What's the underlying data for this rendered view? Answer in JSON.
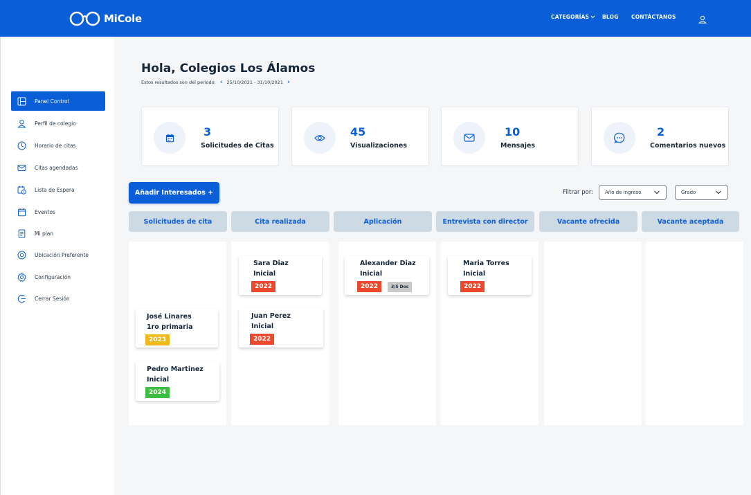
{
  "header": {
    "logo_text": "MiCole",
    "nav": {
      "categories": "CATEGORÍAS",
      "blog": "BLOG",
      "contact": "CONTÁCTANOS"
    }
  },
  "sidebar": {
    "items": [
      {
        "label": "Panel Control",
        "icon": "layout-icon",
        "active": true
      },
      {
        "label": "Perfil de colegio",
        "icon": "user-icon"
      },
      {
        "label": "Horario de citas",
        "icon": "clock-icon"
      },
      {
        "label": "Citas agendadas",
        "icon": "mail-icon"
      },
      {
        "label": "Lista de Espera",
        "icon": "calendar-clock-icon"
      },
      {
        "label": "Eventos",
        "icon": "calendar-icon"
      },
      {
        "label": "Mi plan",
        "icon": "document-icon"
      },
      {
        "label": "Ubicación Preferente",
        "icon": "location-icon"
      },
      {
        "label": "Configuración",
        "icon": "gear-icon"
      },
      {
        "label": "Cerrar Sesión",
        "icon": "logout-icon"
      }
    ]
  },
  "main": {
    "greeting": "Hola, Colegios Los Álamos",
    "period_label": "Estos resultados son del periodo:",
    "period_range": "25/10/2021 - 31/10/2021",
    "stats": [
      {
        "value": "3",
        "caption": "Solicitudes de Citas",
        "icon": "calendar-icon"
      },
      {
        "value": "45",
        "caption": "Visualizaciones",
        "icon": "eye-icon"
      },
      {
        "value": "10",
        "caption": "Mensajes",
        "icon": "envelope-icon"
      },
      {
        "value": "2",
        "caption": "Comentarios nuevos",
        "icon": "chat-bubble-icon"
      }
    ],
    "add_button": "Añadir Interesados +",
    "filter_label": "Filtrar por:",
    "filters": {
      "year": "Año de ingreso",
      "grade": "Grado"
    },
    "columns": [
      {
        "title": "Solicitudes de cita"
      },
      {
        "title": "Cita realizada"
      },
      {
        "title": "Aplicación"
      },
      {
        "title": "Entrevista con director"
      },
      {
        "title": "Vacante ofrecida"
      },
      {
        "title": "Vacante aceptada"
      }
    ],
    "cards": [
      {
        "name": "José Linares",
        "level": "1ro primaria",
        "year": "2023",
        "year_color": "#f1b81a"
      },
      {
        "name": "Pedro Martinez",
        "level": "Inicial",
        "year": "2024",
        "year_color": "#3fbf3f"
      },
      {
        "name": "Sara Diaz",
        "level": "Inicial",
        "year": "2022",
        "year_color": "#ec4a2e"
      },
      {
        "name": "Juan Perez",
        "level": "Inicial",
        "year": "2022",
        "year_color": "#ec4a2e"
      },
      {
        "name": "Alexander Diaz",
        "level": "Inicial",
        "year": "2022",
        "year_color": "#ec4a2e",
        "doc_badge": "3/5 Doc"
      },
      {
        "name": "Maria Torres",
        "level": "Inicial",
        "year": "2022",
        "year_color": "#ec4a2e"
      }
    ]
  },
  "colors": {
    "primary": "#0a5ed7",
    "column_header_bg": "#cdd9e3",
    "page_bg": "#f5f6f8"
  }
}
